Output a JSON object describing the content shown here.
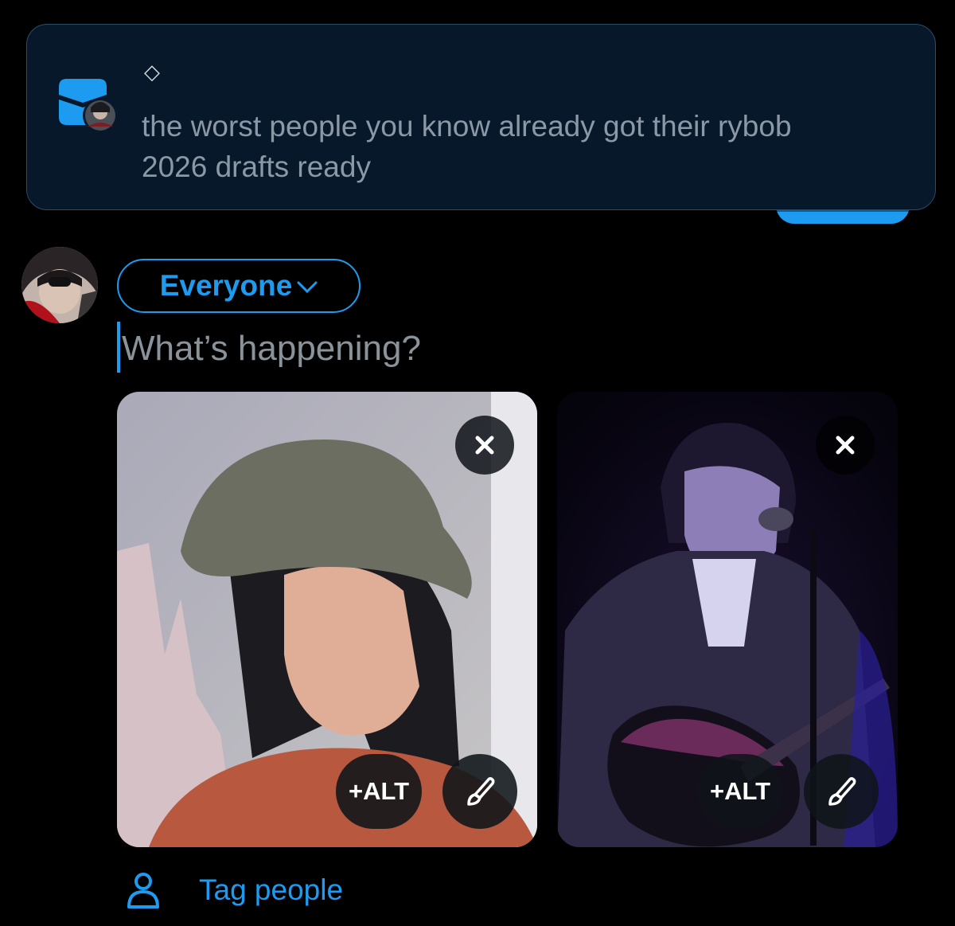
{
  "banner": {
    "app_icon": "inbox-tray-icon",
    "decoration_glyph": "◇",
    "message": "the worst people you know already got their rybob 2026 drafts ready"
  },
  "composer": {
    "audience_label": "Everyone",
    "input_placeholder": "What’s happening?",
    "media": [
      {
        "alt_label": "+ALT",
        "remove_icon": "close-icon",
        "edit_icon": "brush-icon"
      },
      {
        "alt_label": "+ALT",
        "remove_icon": "close-icon",
        "edit_icon": "brush-icon"
      }
    ],
    "tag_people_label": "Tag people",
    "tag_people_icon": "person-icon"
  },
  "colors": {
    "accent": "#1d9bf0",
    "banner_bg": "#07182a",
    "background": "#000000"
  }
}
